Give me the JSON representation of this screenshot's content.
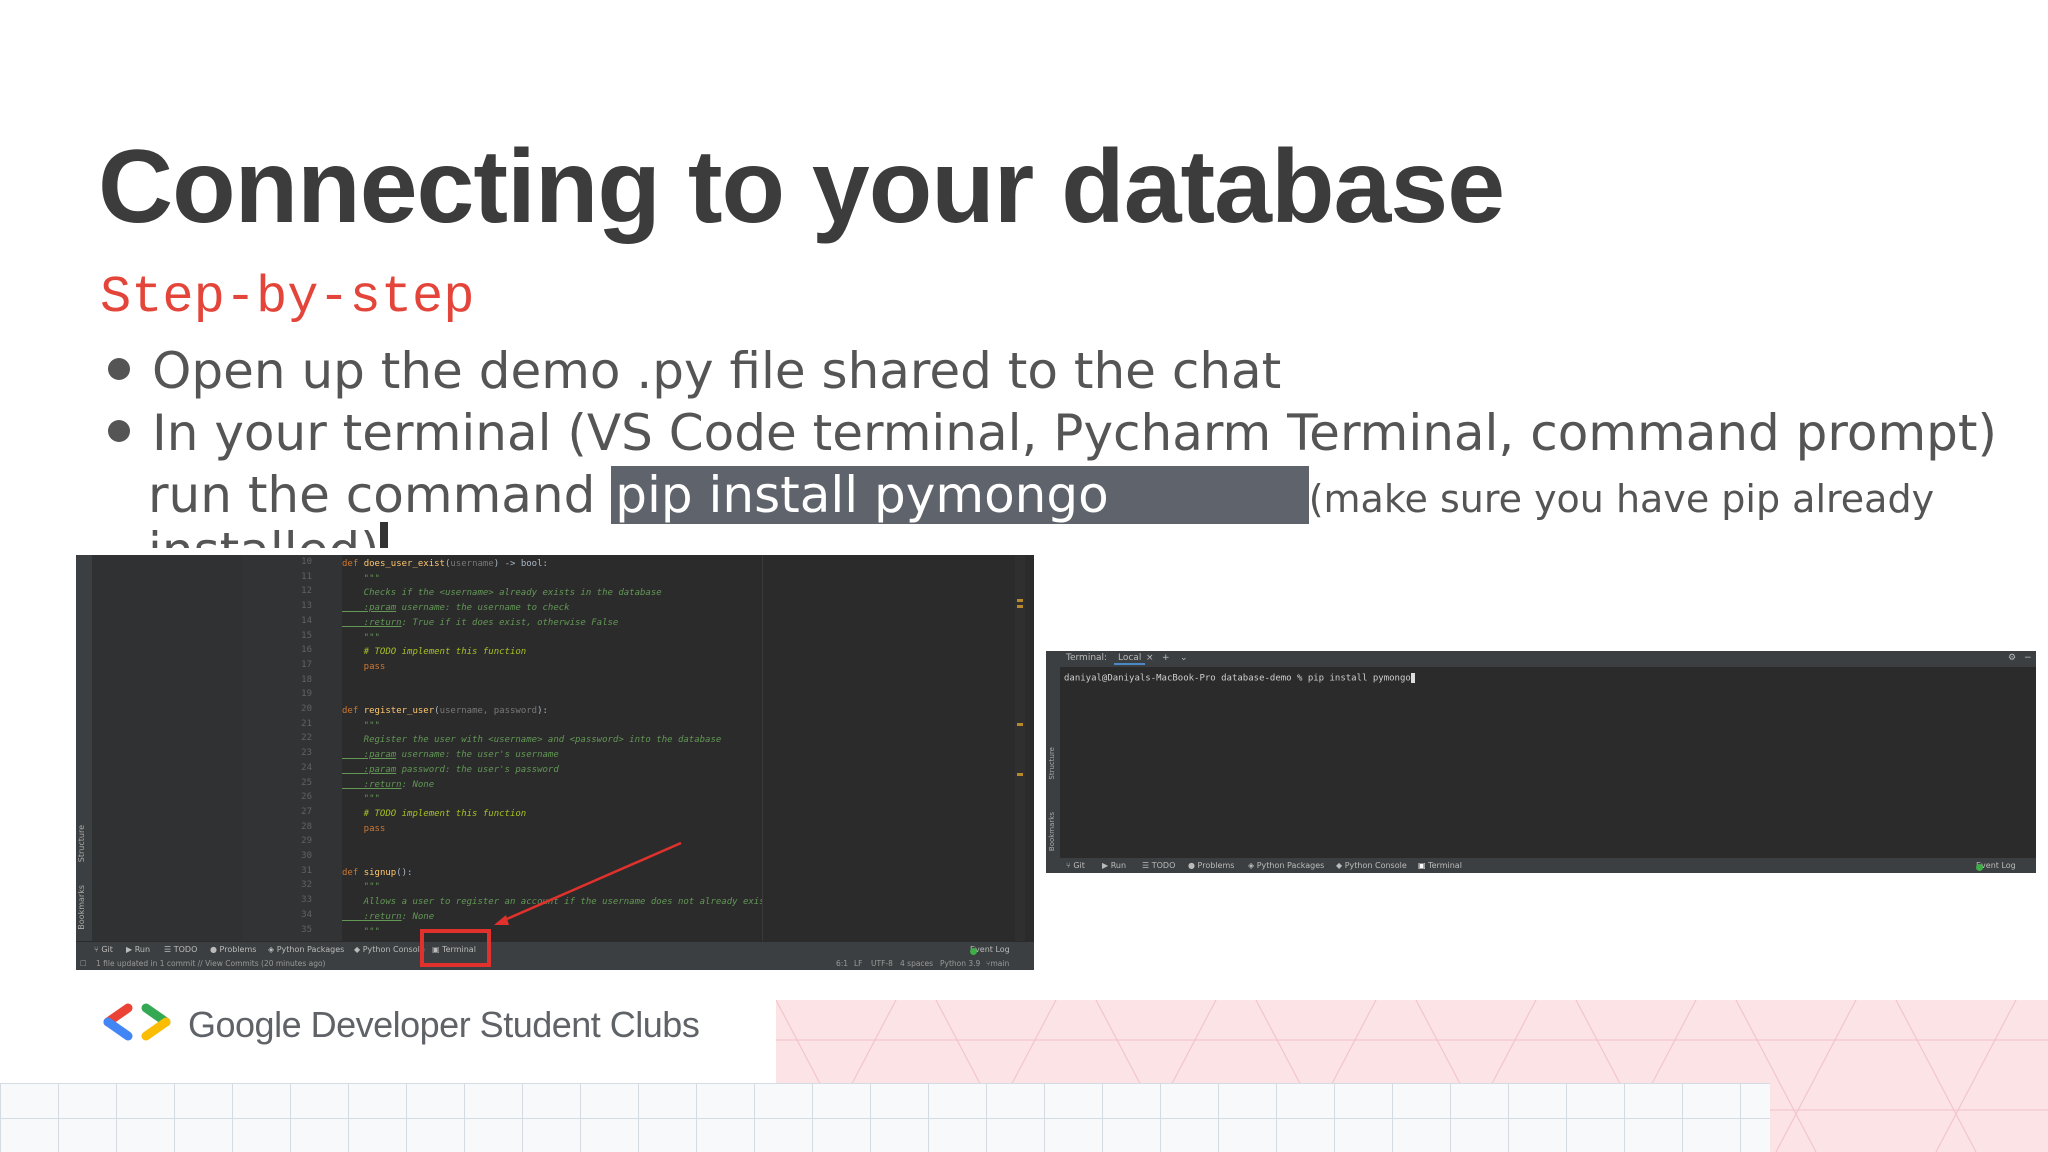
{
  "slide": {
    "title": "Connecting to your database",
    "subtitle": "Step-by-step",
    "bullets": [
      "Open up the demo .py file shared to the chat",
      "In your terminal (VS Code terminal, Pycharm Terminal, command prompt)"
    ],
    "run_prefix": "run the command ",
    "command": "pip install pymongo",
    "note": "(make sure you have pip already",
    "note_cont": "installed)"
  },
  "ide": {
    "code_lines": [
      {
        "n": "10",
        "t": [
          [
            "kw",
            "def "
          ],
          [
            "fn",
            "does_user_exist"
          ],
          [
            "",
            "("
          ],
          [
            "param",
            "username"
          ],
          [
            "",
            ") -> bool:"
          ]
        ]
      },
      {
        "n": "11",
        "t": [
          [
            "cm",
            "    \"\"\""
          ]
        ]
      },
      {
        "n": "12",
        "t": [
          [
            "cm",
            "    Checks if the <username> already exists in the database"
          ]
        ]
      },
      {
        "n": "13",
        "t": [
          [
            "tag",
            "    :param"
          ],
          [
            "cm",
            " username: the username to check"
          ]
        ]
      },
      {
        "n": "14",
        "t": [
          [
            "tag",
            "    :return"
          ],
          [
            "cm",
            ": True if it does exist, otherwise False"
          ]
        ]
      },
      {
        "n": "15",
        "t": [
          [
            "cm",
            "    \"\"\""
          ]
        ]
      },
      {
        "n": "16",
        "t": [
          [
            "todo",
            "    # TODO implement this function"
          ]
        ]
      },
      {
        "n": "17",
        "t": [
          [
            "kw",
            "    pass"
          ]
        ]
      },
      {
        "n": "18",
        "t": [
          [
            "",
            ""
          ]
        ]
      },
      {
        "n": "19",
        "t": [
          [
            "",
            ""
          ]
        ]
      },
      {
        "n": "20",
        "t": [
          [
            "kw",
            "def "
          ],
          [
            "fn",
            "register_user"
          ],
          [
            "",
            "("
          ],
          [
            "param",
            "username, password"
          ],
          [
            "",
            "):"
          ]
        ]
      },
      {
        "n": "21",
        "t": [
          [
            "cm",
            "    \"\"\""
          ]
        ]
      },
      {
        "n": "22",
        "t": [
          [
            "cm",
            "    Register the user with <username> and <password> into the database"
          ]
        ]
      },
      {
        "n": "23",
        "t": [
          [
            "tag",
            "    :param"
          ],
          [
            "cm",
            " username: the user's username"
          ]
        ]
      },
      {
        "n": "24",
        "t": [
          [
            "tag",
            "    :param"
          ],
          [
            "cm",
            " password: the user's password"
          ]
        ]
      },
      {
        "n": "25",
        "t": [
          [
            "tag",
            "    :return"
          ],
          [
            "cm",
            ": None"
          ]
        ]
      },
      {
        "n": "26",
        "t": [
          [
            "cm",
            "    \"\"\""
          ]
        ]
      },
      {
        "n": "27",
        "t": [
          [
            "todo",
            "    # TODO implement this function"
          ]
        ]
      },
      {
        "n": "28",
        "t": [
          [
            "kw",
            "    pass"
          ]
        ]
      },
      {
        "n": "29",
        "t": [
          [
            "",
            ""
          ]
        ]
      },
      {
        "n": "30",
        "t": [
          [
            "",
            ""
          ]
        ]
      },
      {
        "n": "31",
        "t": [
          [
            "kw",
            "def "
          ],
          [
            "fn",
            "signup"
          ],
          [
            "",
            "():"
          ]
        ]
      },
      {
        "n": "32",
        "t": [
          [
            "cm",
            "    \"\"\""
          ]
        ]
      },
      {
        "n": "33",
        "t": [
          [
            "cm",
            "    Allows a user to register an account if the username does not already exist"
          ]
        ]
      },
      {
        "n": "34",
        "t": [
          [
            "tag",
            "    :return"
          ],
          [
            "cm",
            ": None"
          ]
        ]
      },
      {
        "n": "35",
        "t": [
          [
            "cm",
            "    \"\"\""
          ]
        ]
      }
    ],
    "side_labels": [
      "Structure",
      "Bookmarks"
    ],
    "toolbar": [
      "Git",
      "Run",
      "TODO",
      "Problems",
      "Python Packages",
      "Python Console",
      "Terminal"
    ],
    "event_log": "Event Log",
    "status_left": "1 file updated in 1 commit // View Commits (20 minutes ago)",
    "status_right": [
      "6:1",
      "LF",
      "UTF-8",
      "4 spaces",
      "Python 3.9",
      "main"
    ]
  },
  "terminal": {
    "label": "Terminal:",
    "tab": "Local",
    "add": "+",
    "command_line": "daniyal@Daniyals-MacBook-Pro database-demo % pip install pymongo",
    "side_labels": [
      "Structure",
      "Bookmarks"
    ],
    "toolbar": [
      "Git",
      "Run",
      "TODO",
      "Problems",
      "Python Packages",
      "Python Console",
      "Terminal"
    ],
    "event_log": "Event Log"
  },
  "footer": {
    "brand": "Google Developer Student Clubs",
    "colors": {
      "red": "#ea4335",
      "blue": "#4285f4",
      "green": "#34a853",
      "yellow": "#fbbc04"
    }
  },
  "colors": {
    "title": "#3c3c3c",
    "subtitle": "#e4453a",
    "highlight": "#e0312c"
  }
}
